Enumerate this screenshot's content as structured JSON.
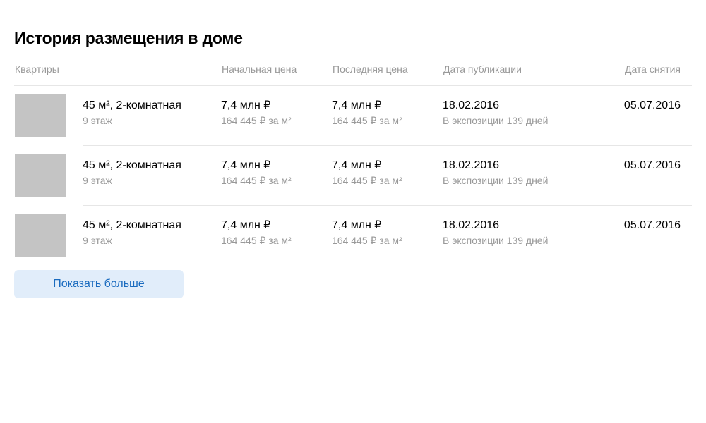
{
  "title": "История размещения в доме",
  "columns": {
    "apartments": "Квартиры",
    "start_price": "Начальная цена",
    "last_price": "Последняя цена",
    "publish_date": "Дата публикации",
    "removed_date": "Дата снятия"
  },
  "rows": [
    {
      "apartment": "45 м², 2-комнатная",
      "floor": "9 этаж",
      "start_price": "7,4 млн ₽",
      "start_price_per_m2": "164 445 ₽ за м²",
      "last_price": "7,4 млн ₽",
      "last_price_per_m2": "164 445 ₽ за м²",
      "publish_date": "18.02.2016",
      "exposure": "В экспозиции 139 дней",
      "removed_date": "05.07.2016"
    },
    {
      "apartment": "45 м², 2-комнатная",
      "floor": "9 этаж",
      "start_price": "7,4 млн ₽",
      "start_price_per_m2": "164 445 ₽ за м²",
      "last_price": "7,4 млн ₽",
      "last_price_per_m2": "164 445 ₽ за м²",
      "publish_date": "18.02.2016",
      "exposure": "В экспозиции 139 дней",
      "removed_date": "05.07.2016"
    },
    {
      "apartment": "45 м², 2-комнатная",
      "floor": "9 этаж",
      "start_price": "7,4 млн ₽",
      "start_price_per_m2": "164 445 ₽ за м²",
      "last_price": "7,4 млн ₽",
      "last_price_per_m2": "164 445 ₽ за м²",
      "publish_date": "18.02.2016",
      "exposure": "В экспозиции 139 дней",
      "removed_date": "05.07.2016"
    }
  ],
  "show_more_label": "Показать больше",
  "colors": {
    "text": "#000000",
    "muted": "#999999",
    "divider": "#e6e6e6",
    "thumb": "#c4c4c4",
    "button_bg": "#e1edfa",
    "button_text": "#1a6bbf"
  }
}
